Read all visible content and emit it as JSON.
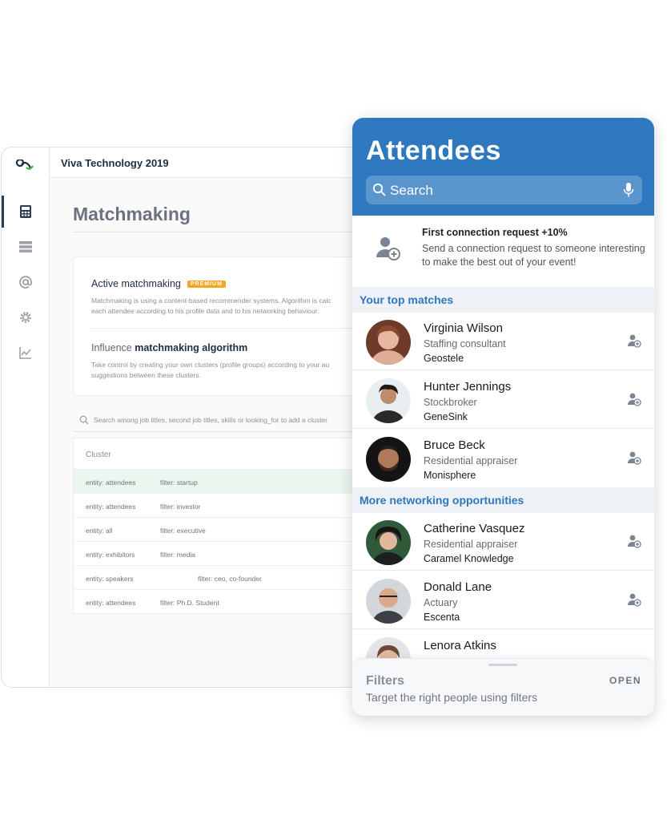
{
  "desktop": {
    "app_title": "Viva Technology 2019",
    "page_title": "Matchmaking",
    "active_section": {
      "title": "Active matchmaking",
      "badge": "PREMIUM",
      "desc_line1": "Matchmaking is using a content-based recommender systems. Algorithm is calc",
      "desc_line2": "each attendee according to his profile data and to his networking behaviour."
    },
    "influence_section": {
      "title_plain": "Influence ",
      "title_bold": "matchmaking algorithm",
      "desc_line1": "Take control by creating your own clusters (profile groups) according to your au",
      "desc_line2": "suggestions between these clusters."
    },
    "cluster_search_placeholder": "Search among job titles, second job titles, skills or looking_for to add a cluster",
    "table_header": "Cluster",
    "clusters": [
      {
        "entity": "entity: attendees",
        "filter": "filter: startup"
      },
      {
        "entity": "entity: attendees",
        "filter": "filter: investor"
      },
      {
        "entity": "entity: all",
        "filter": "filter: executive"
      },
      {
        "entity": "entity: exhibitors",
        "filter": "filter: media"
      },
      {
        "entity": "entity: speakers",
        "filter": "filter: ceo, co-founder"
      },
      {
        "entity": "entity: attendees",
        "filter": "filter: Ph.D. Student"
      }
    ],
    "colors": {
      "accent": "#2e3d55",
      "badge": "#f5a623",
      "selected_row": "#ecf5ee"
    }
  },
  "mobile": {
    "title": "Attendees",
    "search_label": "Search",
    "promo": {
      "title": "First connection request +10%",
      "desc": "Send a connection request to someone interesting to make the best out of your event!"
    },
    "top_matches_label": "Your top matches",
    "top_matches": [
      {
        "name": "Virginia Wilson",
        "job": "Staffing consultant",
        "company": "Geostele"
      },
      {
        "name": "Hunter Jennings",
        "job": "Stockbroker",
        "company": "GeneSink"
      },
      {
        "name": "Bruce Beck",
        "job": "Residential appraiser",
        "company": "Monisphere"
      }
    ],
    "more_label": "More networking opportunities",
    "more": [
      {
        "name": "Catherine Vasquez",
        "job": "Residential appraiser",
        "company": "Caramel Knowledge"
      },
      {
        "name": "Donald Lane",
        "job": "Actuary",
        "company": "Escenta"
      },
      {
        "name": "Lenora Atkins",
        "job": "",
        "company": ""
      }
    ],
    "filters": {
      "title": "Filters",
      "desc": "Target the right people using filters",
      "action": "OPEN"
    },
    "colors": {
      "header": "#2e78bf",
      "section_bg": "#eef2f6",
      "link": "#2e78bf"
    }
  }
}
